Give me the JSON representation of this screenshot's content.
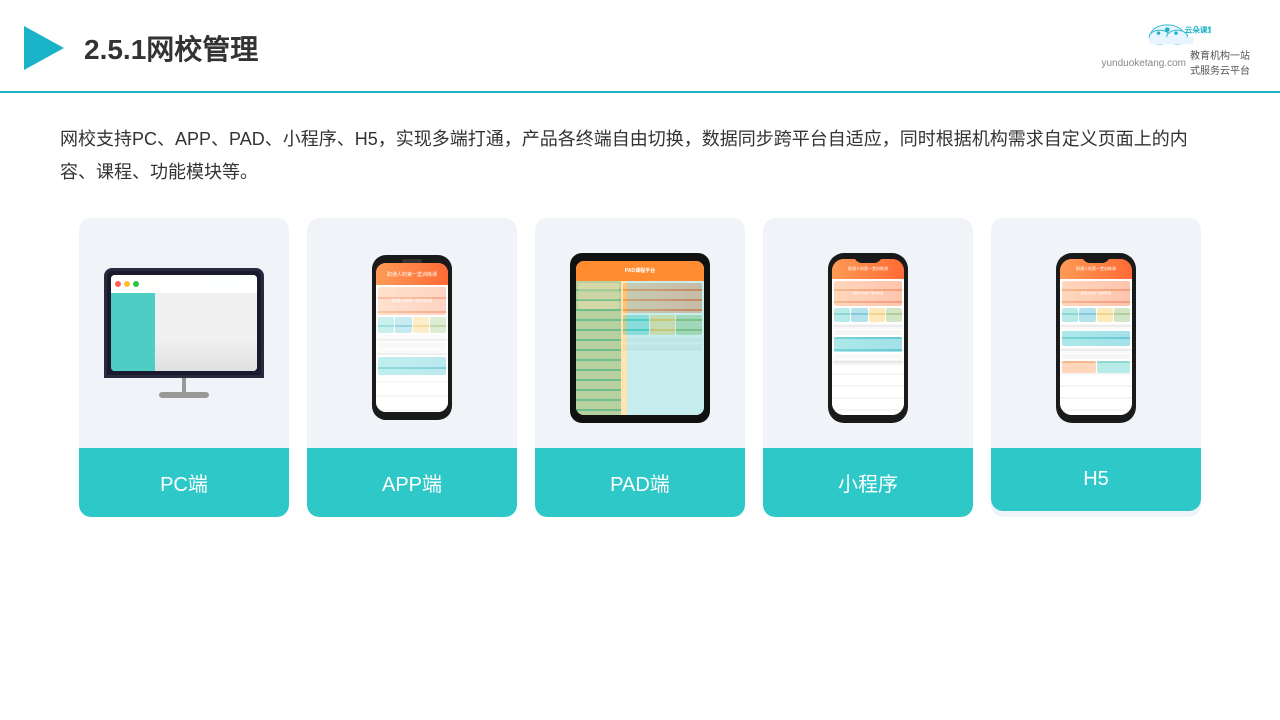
{
  "header": {
    "title": "2.5.1网校管理",
    "logo_url": "yunduoketang.com",
    "logo_tagline": "教育机构一站\n式服务云平台"
  },
  "description": {
    "text": "网校支持PC、APP、PAD、小程序、H5，实现多端打通，产品各终端自由切换，数据同步跨平台自适应，同时根据机构需求自定义页面上的内容、课程、功能模块等。"
  },
  "cards": [
    {
      "id": "pc",
      "label": "PC端"
    },
    {
      "id": "app",
      "label": "APP端"
    },
    {
      "id": "pad",
      "label": "PAD端"
    },
    {
      "id": "miniprogram",
      "label": "小程序"
    },
    {
      "id": "h5",
      "label": "H5"
    }
  ],
  "accent_color": "#2fc8c8",
  "border_color": "#1ab3c8"
}
